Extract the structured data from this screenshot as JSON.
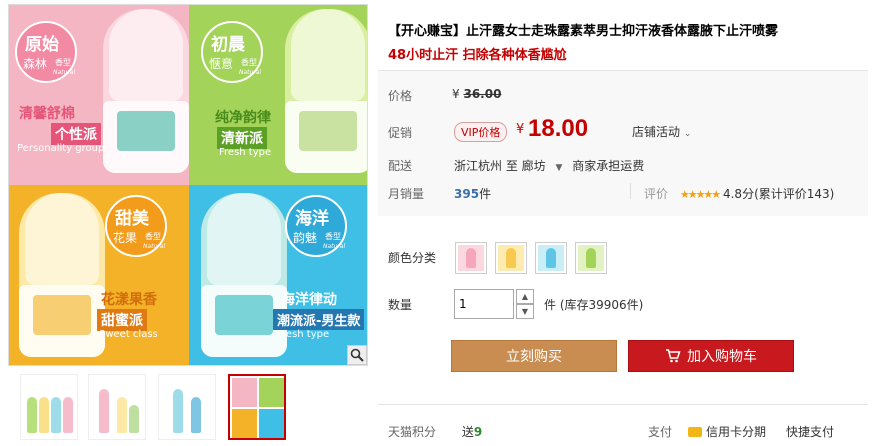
{
  "gallery": {
    "cells": [
      {
        "badge_top": "原始",
        "badge_mid": "森林",
        "badge_type": "香型",
        "badge_en": "Natural",
        "tag_main": "清馨舒棉",
        "tag_box": "个性派",
        "tag_en": "Personality group"
      },
      {
        "badge_top": "初晨",
        "badge_mid": "惬意",
        "badge_type": "香型",
        "badge_en": "Natural",
        "tag_main": "纯净韵律",
        "tag_box": "清新派",
        "tag_en": "Fresh type"
      },
      {
        "badge_top": "甜美",
        "badge_mid": "花果",
        "badge_type": "香型",
        "badge_en": "Natural",
        "tag_main": "花漾果香",
        "tag_box": "甜蜜派",
        "tag_en": "Sweet class"
      },
      {
        "badge_top": "海洋",
        "badge_mid": "韵魅",
        "badge_type": "香型",
        "badge_en": "Natural",
        "tag_main": "海洋律动",
        "tag_box": "潮流派-男生款",
        "tag_en": "Fresh type"
      }
    ],
    "zoom_icon": "magnifier-icon",
    "thumbnails_count": 4,
    "active_thumbnail": 4
  },
  "product": {
    "title": "【开心赚宝】止汗露女士走珠露素萃男士抑汗液香体露腋下止汗喷雾",
    "subtitle": "48小时止汗 扫除各种体香尴尬"
  },
  "price": {
    "label": "价格",
    "currency": "¥",
    "original": "36.00"
  },
  "promo": {
    "label": "促销",
    "vip_tag": "VIP价格",
    "currency": "¥",
    "price": "18.00",
    "activity": "店铺活动"
  },
  "shipping": {
    "label": "配送",
    "text": "浙江杭州 至  廊坊",
    "fee": "商家承担运费"
  },
  "sales": {
    "label": "月销量",
    "count": "395",
    "unit": "件"
  },
  "rating": {
    "label": "评价",
    "stars": "★★★★★",
    "text": "4.8分(累计评价143)"
  },
  "colors": {
    "label": "颜色分类",
    "swatches": [
      "pink",
      "yellow",
      "blue",
      "green"
    ]
  },
  "quantity": {
    "label": "数量",
    "value": "1",
    "stock": "件 (库存39906件)"
  },
  "actions": {
    "buy_now": "立刻购买",
    "add_cart": "加入购物车"
  },
  "footer": {
    "points_label": "天猫积分",
    "points_prefix": "送",
    "points_value": "9",
    "pay_label": "支付",
    "credit": "信用卡分期",
    "quick_pay": "快捷支付"
  },
  "colors_hex": {
    "accent": "#c40000",
    "buy": "#c98d52",
    "cart": "#c8191e"
  }
}
